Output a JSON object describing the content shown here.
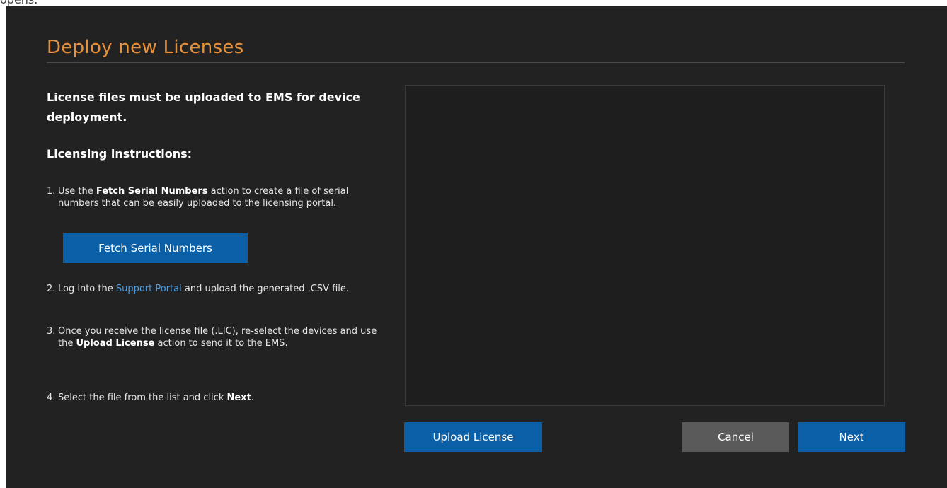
{
  "top_caption": "opens.",
  "dialog": {
    "title": "Deploy new Licenses",
    "intro": "License files must be uploaded to EMS for device deployment.",
    "subhead": "Licensing instructions:",
    "steps": [
      {
        "num": "1.",
        "pre": "Use the ",
        "bold": "Fetch Serial Numbers",
        "post": " action to create a file of serial numbers that can be easily uploaded to the licensing portal."
      },
      {
        "num": "2.",
        "pre": "Log into the ",
        "link": "Support Portal",
        "post": " and upload the generated .CSV file."
      },
      {
        "num": "3.",
        "pre": "Once you receive the license file (.LIC), re-select the devices and use the ",
        "bold": "Upload License",
        "post": " action to send it to the EMS."
      },
      {
        "num": "4.",
        "pre": "Select the file from the list and click ",
        "bold": "Next",
        "post": "."
      }
    ],
    "buttons": {
      "fetch": "Fetch Serial Numbers",
      "upload": "Upload License",
      "cancel": "Cancel",
      "next": "Next"
    },
    "file_list_items": []
  },
  "colors": {
    "background": "#222222",
    "title": "#e8913a",
    "primary_button": "#0a5fa6",
    "secondary_button": "#5a5a5a",
    "link": "#4d9de0"
  }
}
